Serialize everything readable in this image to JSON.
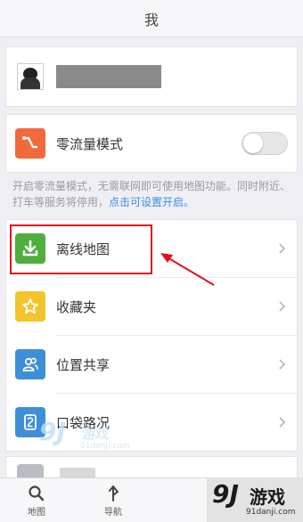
{
  "header": {
    "title": "我"
  },
  "zero_traffic": {
    "label": "零流量模式",
    "enabled": false
  },
  "hint": {
    "text": "开启零流量模式，无需联网即可使用地图功能。同时附近、打车等服务将停用，",
    "link": "点击可设置开启。"
  },
  "menu": [
    {
      "label": "离线地图",
      "icon": "download-icon",
      "color": "#4fae3c"
    },
    {
      "label": "收藏夹",
      "icon": "star-icon",
      "color": "#f3c42b"
    },
    {
      "label": "位置共享",
      "icon": "people-icon",
      "color": "#3f8fd8"
    },
    {
      "label": "口袋路况",
      "icon": "traffic-icon",
      "color": "#3f8fd8"
    }
  ],
  "tabs": [
    {
      "label": "地图",
      "icon": "search-icon"
    },
    {
      "label": "导航",
      "icon": "navigation-icon"
    }
  ],
  "watermark": {
    "big": "9J",
    "text": "游戏",
    "site": "91danji.com"
  },
  "corner_logo": {
    "big": "9J",
    "text": "游戏",
    "site": "91danji.com"
  },
  "colors": {
    "toggle_row_icon": "#f06a3b",
    "highlight": "#e0121b",
    "link": "#3a8ee6"
  }
}
